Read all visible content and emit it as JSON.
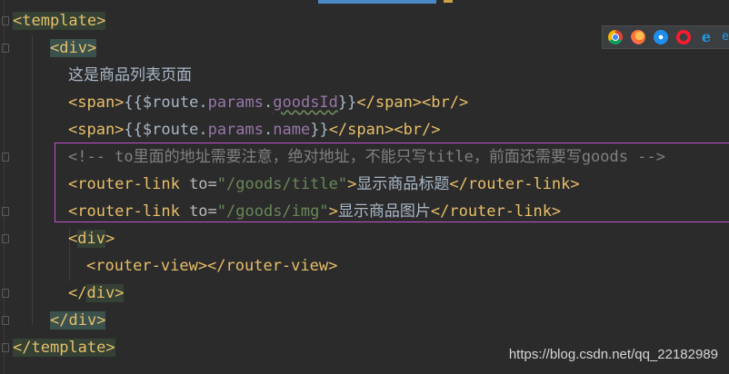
{
  "editor": {
    "lines": [
      {
        "tag": "template"
      },
      {
        "tag": "div"
      },
      {
        "text": "这是商品列表页面"
      },
      {
        "open": "<span>",
        "tpl_open": "{{",
        "route": "$route",
        "dot1": ".",
        "params": "params",
        "dot2": ".",
        "key": "goodsId",
        "tpl_close": "}}",
        "close": "</span><br/>"
      },
      {
        "open": "<span>",
        "tpl_open": "{{",
        "route": "$route",
        "dot1": ".",
        "params": "params",
        "dot2": ".",
        "key": "name",
        "tpl_close": "}}",
        "close": "</span><br/>"
      },
      {
        "comment": "<!-- to里面的地址需要注意，绝对地址，不能只写title，前面还需要写goods -->"
      },
      {
        "open_tag": "<router-link ",
        "attr": "to",
        "eq": "=",
        "value": "\"/goods/title\"",
        "gt": ">",
        "text": "显示商品标题",
        "close": "</router-link>"
      },
      {
        "open_tag": "<router-link ",
        "attr": "to",
        "eq": "=",
        "value": "\"/goods/img\"",
        "gt": ">",
        "text": "显示商品图片",
        "close": "</router-link>"
      },
      {
        "lt": "<",
        "tag": "div",
        "gt": ">"
      },
      {
        "code": "<router-view></router-view>"
      },
      {
        "lt": "</",
        "tag": "div",
        "gt": ">"
      },
      {
        "lt": "</",
        "tag": "div",
        "gt": ">"
      },
      {
        "lt": "</",
        "tag": "template",
        "gt": ">"
      }
    ]
  },
  "browser_icons": [
    "chrome-icon",
    "firefox-icon",
    "safari-icon",
    "opera-icon",
    "ie-icon"
  ],
  "watermark": "https://blog.csdn.net/qq_22182989",
  "colors": {
    "background": "#2b2b2b",
    "tag": "#e8bf6a",
    "string": "#6a8759",
    "comment": "#808080",
    "property": "#9876aa",
    "selection_border": "#c34fcf"
  }
}
